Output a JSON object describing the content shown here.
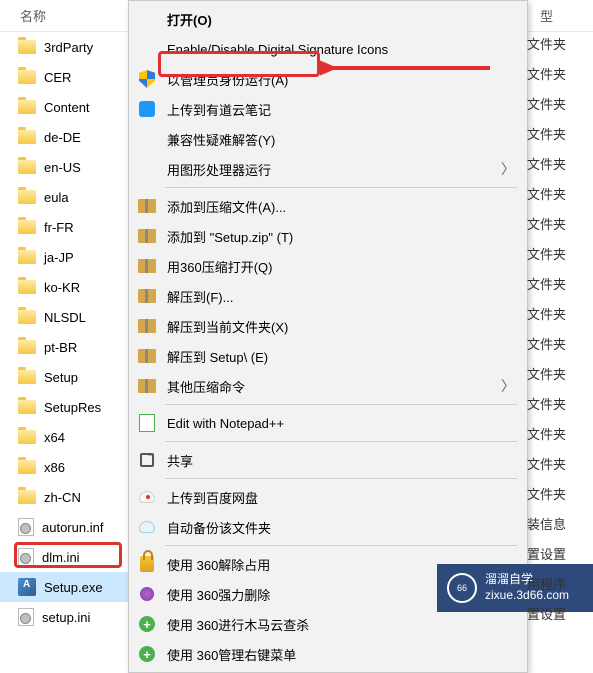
{
  "header": {
    "name": "名称",
    "type": "型"
  },
  "files": [
    {
      "icon": "folder",
      "name": "3rdParty",
      "type": "文件夹"
    },
    {
      "icon": "folder",
      "name": "CER",
      "type": "文件夹"
    },
    {
      "icon": "folder",
      "name": "Content",
      "type": "文件夹"
    },
    {
      "icon": "folder",
      "name": "de-DE",
      "type": "文件夹"
    },
    {
      "icon": "folder",
      "name": "en-US",
      "type": "文件夹"
    },
    {
      "icon": "folder",
      "name": "eula",
      "type": "文件夹"
    },
    {
      "icon": "folder",
      "name": "fr-FR",
      "type": "文件夹"
    },
    {
      "icon": "folder",
      "name": "ja-JP",
      "type": "文件夹"
    },
    {
      "icon": "folder",
      "name": "ko-KR",
      "type": "文件夹"
    },
    {
      "icon": "folder",
      "name": "NLSDL",
      "type": "文件夹"
    },
    {
      "icon": "folder",
      "name": "pt-BR",
      "type": "文件夹"
    },
    {
      "icon": "folder",
      "name": "Setup",
      "type": "文件夹"
    },
    {
      "icon": "folder",
      "name": "SetupRes",
      "type": "文件夹"
    },
    {
      "icon": "folder",
      "name": "x64",
      "type": "文件夹"
    },
    {
      "icon": "folder",
      "name": "x86",
      "type": "文件夹"
    },
    {
      "icon": "folder",
      "name": "zh-CN",
      "type": "文件夹"
    },
    {
      "icon": "ini",
      "name": "autorun.inf",
      "type": "装信息"
    },
    {
      "icon": "ini",
      "name": "dlm.ini",
      "type": "置设置"
    },
    {
      "icon": "exe",
      "name": "Setup.exe",
      "type": "用程序",
      "selected": true
    },
    {
      "icon": "ini",
      "name": "setup.ini",
      "type": "置设置"
    }
  ],
  "menu": [
    {
      "label": "打开(O)",
      "bold": true
    },
    {
      "label": "Enable/Disable Digital Signature Icons"
    },
    {
      "icon": "shield",
      "label": "以管理员身份运行(A)"
    },
    {
      "icon": "cloud-note",
      "label": "上传到有道云笔记"
    },
    {
      "label": "兼容性疑难解答(Y)"
    },
    {
      "label": "用图形处理器运行",
      "arrow": true
    },
    {
      "sep": true
    },
    {
      "icon": "zip",
      "label": "添加到压缩文件(A)..."
    },
    {
      "icon": "zip",
      "label": "添加到 \"Setup.zip\" (T)"
    },
    {
      "icon": "zip",
      "label": "用360压缩打开(Q)"
    },
    {
      "icon": "zip",
      "label": "解压到(F)..."
    },
    {
      "icon": "zip",
      "label": "解压到当前文件夹(X)"
    },
    {
      "icon": "zip",
      "label": "解压到 Setup\\ (E)"
    },
    {
      "icon": "zip",
      "label": "其他压缩命令",
      "arrow": true
    },
    {
      "sep": true
    },
    {
      "icon": "notepad",
      "label": "Edit with Notepad++"
    },
    {
      "sep": true
    },
    {
      "icon": "share",
      "label": "共享"
    },
    {
      "sep": true
    },
    {
      "icon": "baidu",
      "label": "上传到百度网盘"
    },
    {
      "icon": "baidu-backup",
      "label": "自动备份该文件夹"
    },
    {
      "sep": true
    },
    {
      "icon": "lock360",
      "label": "使用 360解除占用"
    },
    {
      "icon": "del360",
      "label": "使用 360强力删除"
    },
    {
      "icon": "green-plus",
      "label": "使用 360进行木马云查杀"
    },
    {
      "icon": "green-plus",
      "label": "使用 360管理右键菜单"
    }
  ],
  "watermark": {
    "brand": "溜溜自学",
    "url": "zixue.3d66.com"
  }
}
